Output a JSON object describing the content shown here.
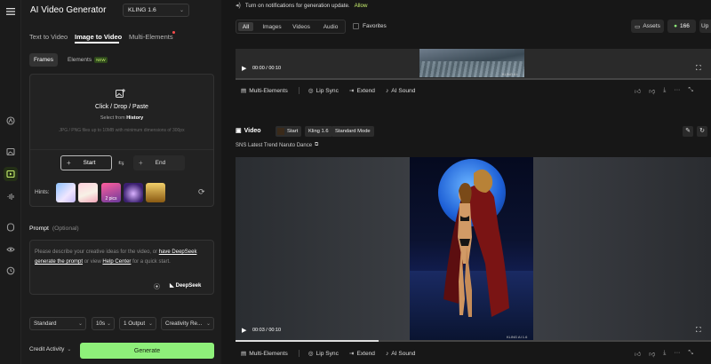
{
  "app_title": "AI Video Generator",
  "model_select": "KLING 1.6",
  "tabs": [
    {
      "label": "Text to Video"
    },
    {
      "label": "Image to Video"
    },
    {
      "label": "Multi-Elements"
    }
  ],
  "subtabs": {
    "frames": "Frames",
    "elements": "Elements",
    "new_badge": "NEW"
  },
  "upload": {
    "title": "Click / Drop / Paste",
    "select_prefix": "Select from",
    "select_link": "History",
    "note": "JPG / PNG files up to 10MB with minimum dimensions of 300px"
  },
  "frames": {
    "start": "Start",
    "end": "End"
  },
  "hints": {
    "label": "Hints:",
    "pics_label": "2 pics"
  },
  "prompt": {
    "label": "Prompt",
    "optional": "(Optional)",
    "placeholder_1": "Please describe your creative ideas for the video, or",
    "link_1": "have DeepSeek generate the prompt",
    "placeholder_2": "or view",
    "link_2": "Help Center",
    "placeholder_3": "for a quick start.",
    "deepseek": "DeepSeek"
  },
  "settings": {
    "mode": "Standard",
    "duration": "10s",
    "outputs": "1 Output",
    "creativity": "Creativity Re..."
  },
  "footer": {
    "credit": "Credit Activity",
    "generate": "Generate"
  },
  "notification": {
    "text": "Turn on notifications for generation update.",
    "allow": "Allow"
  },
  "filters": {
    "all": "All",
    "images": "Images",
    "videos": "Videos",
    "audio": "Audio",
    "favorites": "Favorites"
  },
  "top_right": {
    "assets": "Assets",
    "credits": "166",
    "upgrade": "Up"
  },
  "video1": {
    "time": "00:00 / 00:10",
    "watermark": "KLING AI"
  },
  "actions": {
    "multi": "Multi-Elements",
    "lip": "Lip Sync",
    "extend": "Extend",
    "sound": "AI Sound"
  },
  "video2_header": {
    "title": "Video",
    "start_chip": "Start",
    "model_chip": "Kling 1.6",
    "mode_chip": "Standard Mode",
    "prompt": "SNS Latest Trend Naruto Dance"
  },
  "video2": {
    "time": "00:03 / 00:10",
    "watermark": "KLING AI 1.6",
    "progress": 0.3
  },
  "colors": {
    "accent": "#c8f06e",
    "generate_bg": "#8ef07a",
    "upgrade_bg": "#c8f06e"
  }
}
